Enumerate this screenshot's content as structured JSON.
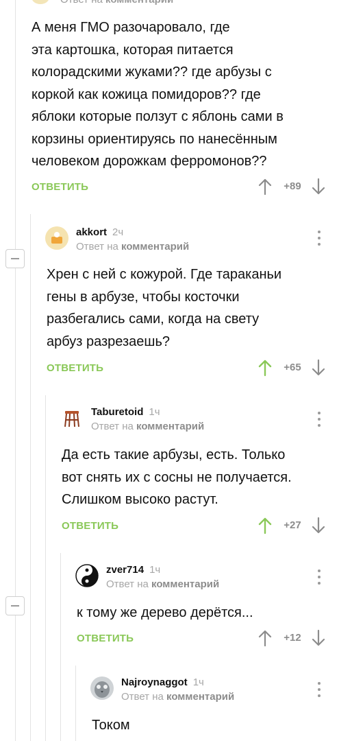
{
  "top_comment": {
    "meta_prefix": "Ответ на",
    "meta_link": "комментарий",
    "text_lines": [
      "А меня ГМО разочаровало, где",
      "эта картошка, которая питается",
      "колорадскими жуками?? где арбузы с",
      "коркой как кожица помидоров?? где",
      "яблоки которые ползут с яблонь сами в",
      "корзины ориентируясь по нанесённым",
      "человеком дорожкам ферромонов??"
    ],
    "reply_label": "ОТВЕТИТЬ",
    "rating": "+89"
  },
  "comments": [
    {
      "author": "akkort",
      "time": "2ч",
      "reply_prefix": "Ответ на",
      "reply_link": "комментарий",
      "text_lines": [
        "Хрен с ней с кожурой. Где тараканьи",
        "гены в арбузе, чтобы косточки",
        "разбегались сами, когда на свету",
        "арбуз разрезаешь?"
      ],
      "reply_label": "ОТВЕТИТЬ",
      "rating": "+65",
      "upvoted": true
    },
    {
      "author": "Taburetoid",
      "time": "1ч",
      "reply_prefix": "Ответ на",
      "reply_link": "комментарий",
      "text_lines": [
        "Да есть такие арбузы, есть. Только",
        "вот снять их с сосны не получается.",
        "Слишком высоко растут."
      ],
      "reply_label": "ОТВЕТИТЬ",
      "rating": "+27",
      "upvoted": true
    },
    {
      "author": "zver714",
      "time": "1ч",
      "reply_prefix": "Ответ на",
      "reply_link": "комментарий",
      "text_lines": [
        "к тому же дерево дерётся..."
      ],
      "reply_label": "ОТВЕТИТЬ",
      "rating": "+12",
      "upvoted": false
    },
    {
      "author": "Najroynaggot",
      "time": "1ч",
      "reply_prefix": "Ответ на",
      "reply_link": "комментарий",
      "text_lines": [
        "Током"
      ]
    }
  ],
  "colors": {
    "accent_green": "#8ac858",
    "muted": "#9a9a9a",
    "thread_line": "#e3e3e3"
  },
  "icons": [
    "collapse-icon",
    "upvote-arrow-icon",
    "downvote-arrow-icon",
    "more-options-icon"
  ]
}
